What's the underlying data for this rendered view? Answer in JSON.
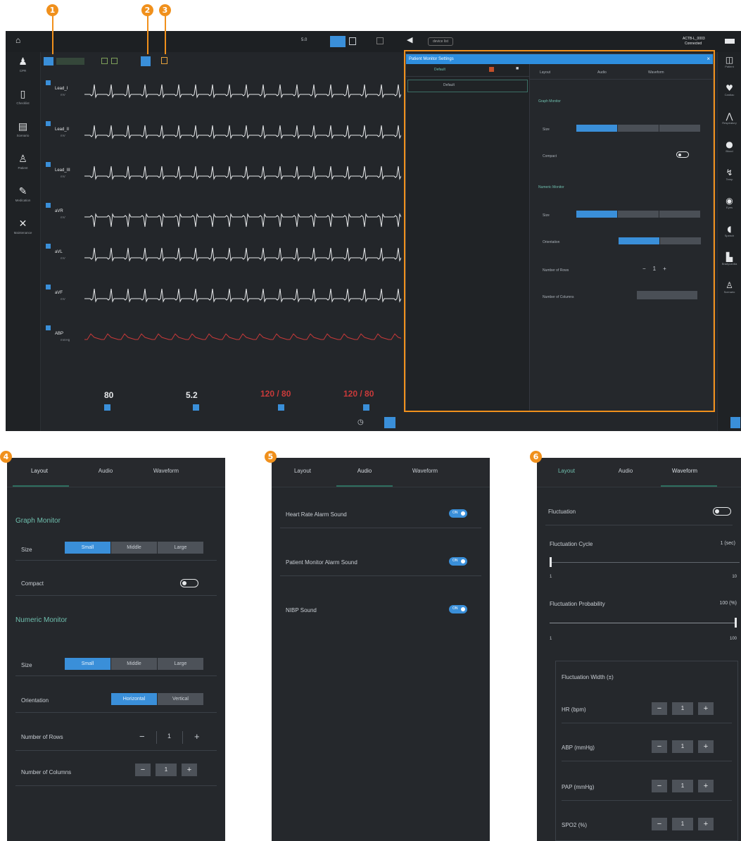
{
  "callouts": [
    "1",
    "2",
    "3",
    "4",
    "5",
    "6"
  ],
  "topbar": {
    "zoom": "5.0",
    "pill": "device list",
    "device_name": "ACTB-L_0003",
    "device_status": "Connected"
  },
  "left_nav": [
    {
      "icon": "person-icon",
      "label": "CPR"
    },
    {
      "icon": "tablet-icon",
      "label": "Checklist"
    },
    {
      "icon": "list-icon",
      "label": "Scenario"
    },
    {
      "icon": "user-icon",
      "label": "Patient"
    },
    {
      "icon": "syringe-icon",
      "label": "Medication"
    },
    {
      "icon": "tools-icon",
      "label": "Maintenance"
    }
  ],
  "right_nav": [
    {
      "icon": "window-icon",
      "label": "Patient"
    },
    {
      "icon": "heart-icon",
      "label": "Cardiac"
    },
    {
      "icon": "lungs-icon",
      "label": "Respiratory"
    },
    {
      "icon": "drop-icon",
      "label": "Blood"
    },
    {
      "icon": "temp-icon",
      "label": "Temp"
    },
    {
      "icon": "eye-icon",
      "label": "Eyes"
    },
    {
      "icon": "speaker-icon",
      "label": "Speech"
    },
    {
      "icon": "bed-icon",
      "label": "Bradycardia"
    },
    {
      "icon": "profile-icon",
      "label": "Scenario"
    }
  ],
  "leads": [
    {
      "name": "Lead_I",
      "unit": "mV"
    },
    {
      "name": "Lead_II",
      "unit": "mV"
    },
    {
      "name": "Lead_III",
      "unit": "mV"
    },
    {
      "name": "aVR",
      "unit": "mV"
    },
    {
      "name": "aVL",
      "unit": "mV"
    },
    {
      "name": "aVF",
      "unit": "mV"
    },
    {
      "name": "ABP",
      "unit": "mmHg"
    }
  ],
  "numerics": {
    "hr": "80",
    "temp": "5.2",
    "abp1": "120 / 80",
    "abp2": "120 / 80"
  },
  "settings_window": {
    "title": "Patient Monitor Settings",
    "left_header": "Default",
    "left_item": "Default",
    "tabs": [
      "Layout",
      "Audio",
      "Waveform"
    ],
    "graph": "Graph Monitor",
    "numeric": "Numeric Monitor",
    "size": "Size",
    "compact": "Compact",
    "orientation": "Orientation",
    "rows": "Number of Rows",
    "cols": "Number of Columns"
  },
  "panel4": {
    "tabs": [
      "Layout",
      "Audio",
      "Waveform"
    ],
    "graph_monitor": "Graph Monitor",
    "size_label": "Size",
    "sizes": [
      "Small",
      "Middle",
      "Large"
    ],
    "compact_label": "Compact",
    "numeric_monitor": "Numeric Monitor",
    "size2_label": "Size",
    "orientation_label": "Orientation",
    "orientations": [
      "Horizontal",
      "Vertical"
    ],
    "rows_label": "Number of Rows",
    "rows_value": "1",
    "cols_label": "Number of Columns",
    "cols_value": "1"
  },
  "panel5": {
    "tabs": [
      "Layout",
      "Audio",
      "Waveform"
    ],
    "items": [
      "Heart Rate Alarm Sound",
      "Patient Monitor Alarm Sound",
      "NIBP Sound"
    ],
    "toggle_text": "ON"
  },
  "panel6": {
    "tabs": [
      "Layout",
      "Audio",
      "Waveform"
    ],
    "fluctuation": "Fluctuation",
    "cycle_label": "Fluctuation Cycle",
    "cycle_value": "1 (sec)",
    "cycle_min": "1",
    "cycle_max": "10",
    "prob_label": "Fluctuation Probability",
    "prob_value": "100 (%)",
    "prob_min": "1",
    "prob_max": "100",
    "width_label": "Fluctuation Width (±)",
    "width_items": [
      "HR (bpm)",
      "ABP (mmHg)",
      "PAP (mmHg)",
      "SPO2 (%)"
    ],
    "width_value": "1"
  },
  "colors": {
    "accent": "#3a8fd9",
    "callout": "#f0901c",
    "section": "#6fbfae",
    "ecg": "#e6e8ea",
    "abp": "#c93a3a"
  }
}
